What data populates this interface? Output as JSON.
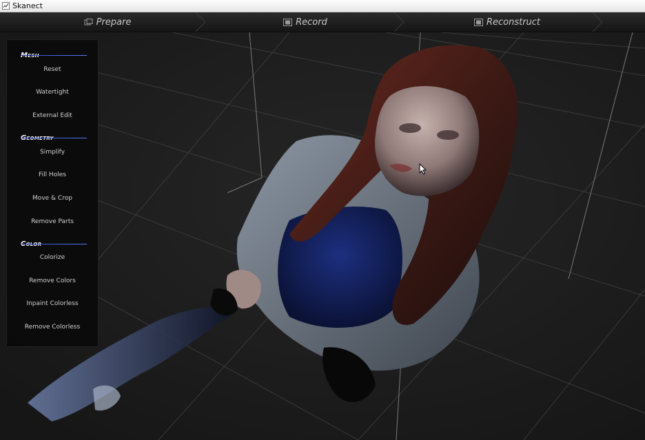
{
  "window": {
    "title": "Skanect"
  },
  "tabs": [
    {
      "label": "Prepare"
    },
    {
      "label": "Record"
    },
    {
      "label": "Reconstruct"
    }
  ],
  "panel": {
    "sections": [
      {
        "title": "Mesh",
        "items": [
          "Reset",
          "Watertight",
          "External Edit"
        ]
      },
      {
        "title": "Geometry",
        "items": [
          "Simplify",
          "Fill Holes",
          "Move & Crop",
          "Remove Parts"
        ]
      },
      {
        "title": "Color",
        "items": [
          "Colorize",
          "Remove Colors",
          "Inpaint Colorless",
          "Remove Colorless"
        ]
      }
    ]
  },
  "colors": {
    "accent": "#3a57e0",
    "background": "#1d1d1d",
    "panel": "#0a0a0a"
  }
}
